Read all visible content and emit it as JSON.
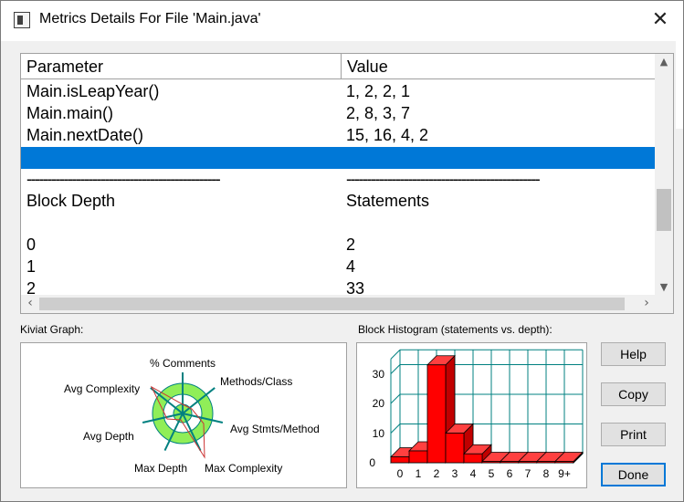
{
  "window": {
    "title": "Metrics Details For File 'Main.java'"
  },
  "table": {
    "headers": {
      "parameter": "Parameter",
      "value": "Value"
    },
    "rows": [
      {
        "param": "Main.isLeapYear()",
        "value": "1, 2, 2, 1"
      },
      {
        "param": "Main.main()",
        "value": "2, 8, 3, 7"
      },
      {
        "param": "Main.nextDate()",
        "value": "15, 16, 4, 2"
      },
      {
        "param": "",
        "value": "",
        "selected": true
      },
      {
        "param": "-----------------------------------------------",
        "value": "-----------------------------------------------"
      },
      {
        "param": "Block Depth",
        "value": "Statements"
      },
      {
        "param": "",
        "value": ""
      },
      {
        "param": "0",
        "value": "2"
      },
      {
        "param": "1",
        "value": "4"
      },
      {
        "param": "2",
        "value": "33"
      }
    ]
  },
  "kiviat": {
    "label": "Kiviat Graph:",
    "axes": [
      "% Comments",
      "Methods/Class",
      "Avg Stmts/Method",
      "Max Complexity",
      "Max Depth",
      "Avg Depth",
      "Avg Complexity"
    ],
    "colors": {
      "outer_ring": "#90ee58",
      "inner_ring": "#ffffff",
      "spoke": "#008080",
      "polygon": "#cc3333"
    }
  },
  "histogram": {
    "label": "Block Histogram (statements vs. depth):",
    "y_ticks": [
      "0",
      "10",
      "20",
      "30"
    ],
    "bar_color": "#ff0000",
    "grid_color": "#008080"
  },
  "chart_data": {
    "type": "bar",
    "title": "Block Histogram (statements vs. depth):",
    "categories": [
      "0",
      "1",
      "2",
      "3",
      "4",
      "5",
      "6",
      "7",
      "8",
      "9+"
    ],
    "values": [
      2,
      4,
      33,
      10,
      3,
      0,
      0,
      0,
      0,
      0
    ],
    "ylim": [
      0,
      35
    ],
    "grid": true
  },
  "buttons": {
    "help": "Help",
    "copy": "Copy",
    "print": "Print",
    "done": "Done"
  }
}
